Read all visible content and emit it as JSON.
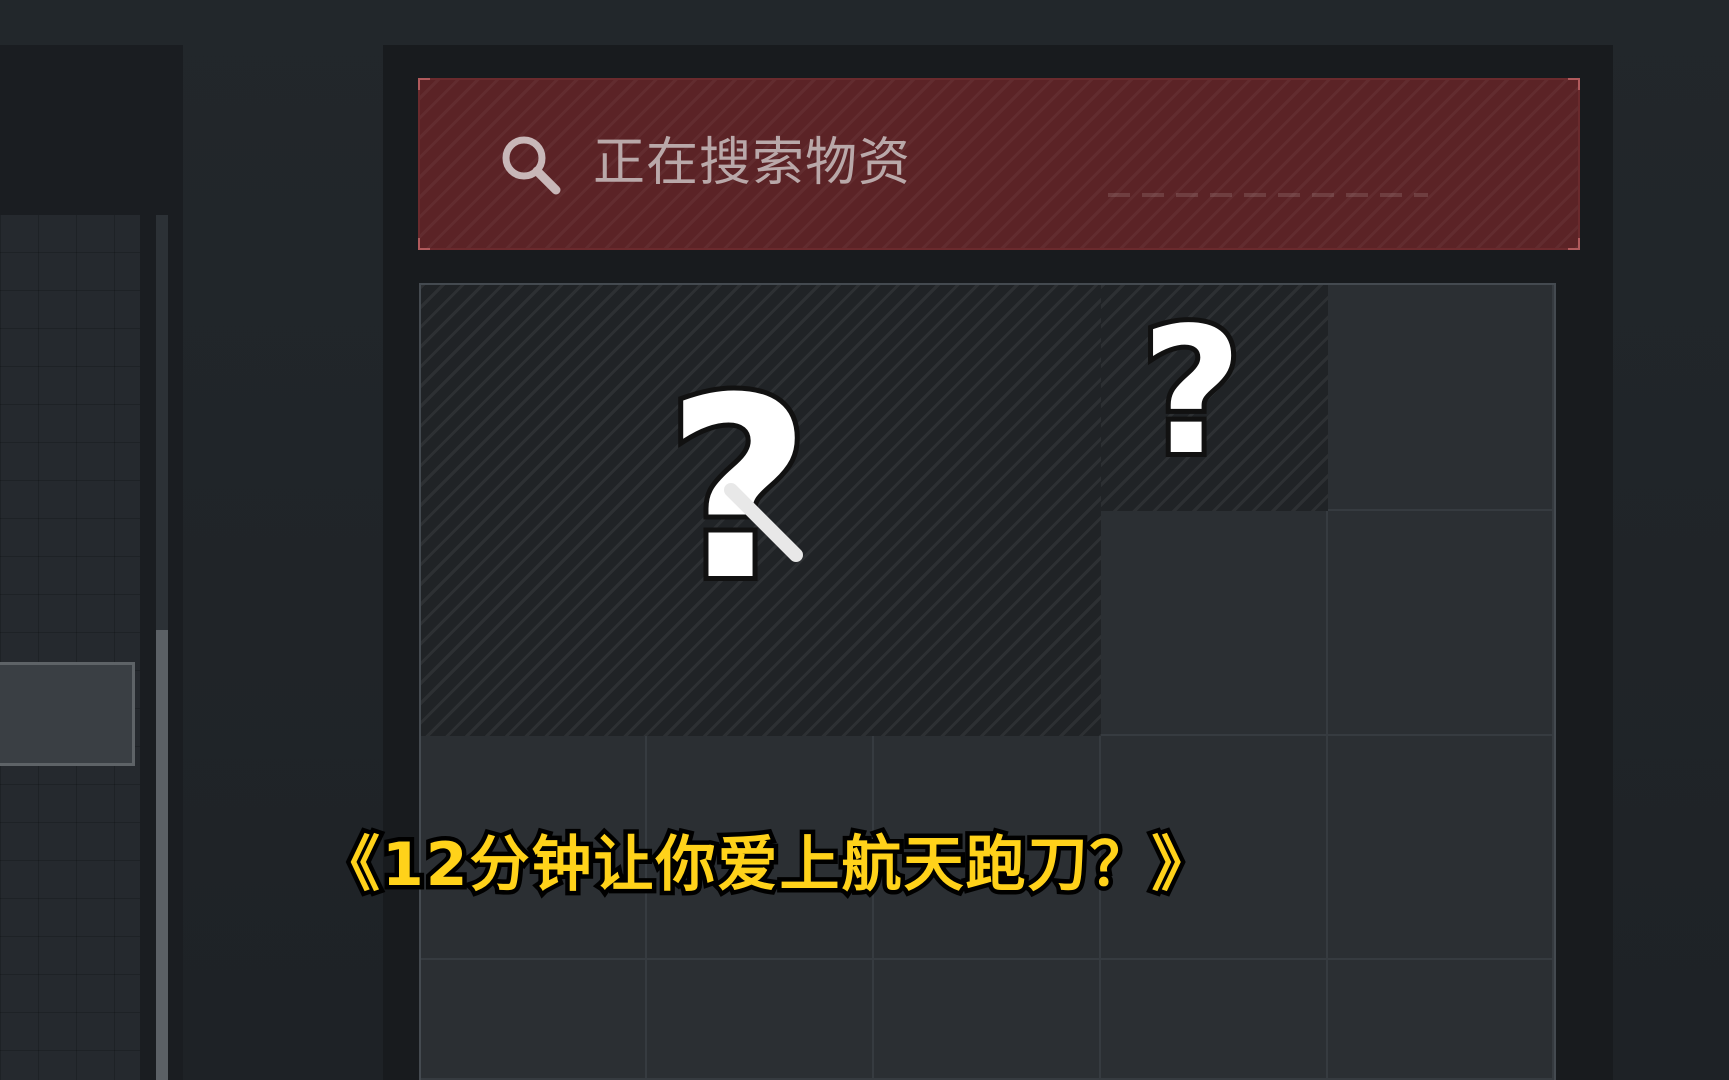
{
  "search": {
    "status_text": "正在搜索物资",
    "icon": "search-icon"
  },
  "items": [
    {
      "name": "unknown-item-large",
      "label": "?"
    },
    {
      "name": "unknown-item-small",
      "label": "?"
    }
  ],
  "subtitle": "《12分钟让你爱上航天跑刀？》",
  "colors": {
    "header_bg": "#5b2326",
    "subtitle": "#ffd21a",
    "panel_bg": "#181b1e"
  }
}
